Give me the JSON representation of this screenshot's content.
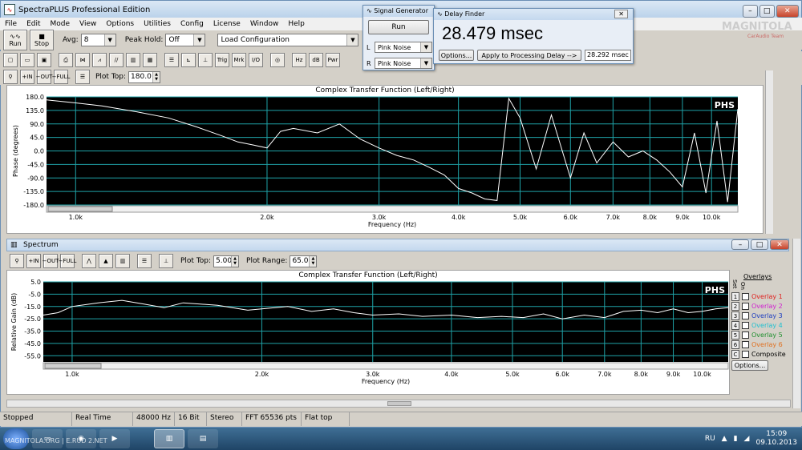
{
  "app": {
    "title": "SpectraPLUS Professional Edition",
    "menu": [
      "File",
      "Edit",
      "Mode",
      "View",
      "Options",
      "Utilities",
      "Config",
      "License",
      "Window",
      "Help"
    ],
    "window_controls": [
      "–",
      "□",
      "✕"
    ]
  },
  "toolbar1": {
    "run_label": "Run",
    "stop_label": "Stop",
    "avg_label": "Avg:",
    "avg_value": "8",
    "peak_hold_label": "Peak Hold:",
    "peak_hold_value": "Off",
    "config_value": "Load Configuration"
  },
  "toolbar2": {
    "buttons": [
      "Trig",
      "Mrk",
      "I/O",
      "Hz",
      "dB",
      "Pwr"
    ]
  },
  "toolbar3": {
    "zoom_labels": [
      "IN",
      "OUT",
      "FULL"
    ],
    "zoom_prefixes": [
      "+",
      "−",
      "−"
    ],
    "plot_top_label": "Plot Top:",
    "plot_top_value": "180.0"
  },
  "phase_chart": {
    "title": "Complex Transfer Function (Left/Right)",
    "ylabel": "Phase (degrees)",
    "xlabel": "Frequency (Hz)",
    "watermark": "PHS"
  },
  "spectrum_window": {
    "title": "Spectrum",
    "plot_top_label": "Plot Top:",
    "plot_top_value": "5.00",
    "plot_range_label": "Plot Range:",
    "plot_range_value": "65.0",
    "chart_title": "Complex Transfer Function (Left/Right)",
    "ylabel": "Relative Gain (dB)",
    "xlabel": "Frequency (Hz)",
    "watermark": "PHS",
    "overlays_title": "Overlays",
    "set_label": "Set",
    "on_label": "On",
    "overlays": [
      {
        "num": "1",
        "name": "Overlay 1",
        "color": "#e0201e"
      },
      {
        "num": "2",
        "name": "Overlay 2",
        "color": "#d020d0"
      },
      {
        "num": "3",
        "name": "Overlay 3",
        "color": "#2040c0"
      },
      {
        "num": "4",
        "name": "Overlay 4",
        "color": "#20c0d0"
      },
      {
        "num": "5",
        "name": "Overlay 5",
        "color": "#209030"
      },
      {
        "num": "6",
        "name": "Overlay 6",
        "color": "#e07020"
      }
    ],
    "composite_num": "C",
    "composite_label": "Composite",
    "options_label": "Options..."
  },
  "signal_generator": {
    "title": "Signal Generator",
    "run_label": "Run",
    "left_label": "L",
    "left_value": "Pink Noise",
    "right_label": "R",
    "right_value": "Pink Noise"
  },
  "delay_finder": {
    "title": "Delay Finder",
    "delay_value": "28.479 msec",
    "options_label": "Options...",
    "apply_label": "Apply to Processing Delay -->",
    "processing_delay": "28.292 msec"
  },
  "statusbar": {
    "items": [
      "Stopped",
      "Real Time",
      "48000 Hz",
      "16 Bit",
      "Stereo",
      "FFT 65536 pts",
      "Flat top"
    ]
  },
  "taskbar": {
    "language": "RU",
    "time": "15:09",
    "date": "09.10.2013",
    "watermark_left": "MAGNITOLA.ORG | E.RUD 2.NET",
    "watermark_right": "MAGNITOLA",
    "watermark_right_sub": "CarAudio Team"
  },
  "chart_data": [
    {
      "type": "line",
      "title": "Complex Transfer Function (Left/Right)",
      "xlabel": "Frequency (Hz)",
      "ylabel": "Phase (degrees)",
      "ylim": [
        -180,
        180
      ],
      "xlim": [
        900,
        11000
      ],
      "x_scale": "log",
      "yticks": [
        "180.0",
        "135.0",
        "90.0",
        "45.0",
        "0.0",
        "-45.0",
        "-90.0",
        "-135.0",
        "-180.0"
      ],
      "ytick_values": [
        180,
        135,
        90,
        45,
        0,
        -45,
        -90,
        -135,
        -180
      ],
      "xticks": [
        "1.0k",
        "2.0k",
        "3.0k",
        "4.0k",
        "5.0k",
        "6.0k",
        "7.0k",
        "8.0k",
        "9.0k",
        "10.0k"
      ],
      "xtick_values": [
        1000,
        2000,
        3000,
        4000,
        5000,
        6000,
        7000,
        8000,
        9000,
        10000
      ],
      "grid": true,
      "series": [
        {
          "x": [
            900,
            1000,
            1100,
            1250,
            1400,
            1550,
            1700,
            1800,
            1900,
            2000,
            2100,
            2200,
            2400,
            2600,
            2800,
            3000,
            3200,
            3400,
            3600,
            3800,
            4000,
            4200,
            4400,
            4600,
            4800,
            5000,
            5300,
            5600,
            6000,
            6300,
            6600,
            7000,
            7400,
            7800,
            8200,
            8600,
            9000,
            9400,
            9800,
            10200,
            10600,
            11000
          ],
          "y": [
            170,
            160,
            150,
            130,
            110,
            80,
            50,
            30,
            20,
            10,
            65,
            75,
            60,
            90,
            40,
            10,
            -15,
            -30,
            -55,
            -80,
            -125,
            -140,
            -160,
            -165,
            175,
            110,
            -60,
            120,
            -90,
            60,
            -40,
            30,
            -20,
            0,
            -30,
            -70,
            -120,
            60,
            -140,
            100,
            -170,
            140
          ]
        }
      ]
    },
    {
      "type": "line",
      "title": "Complex Transfer Function (Left/Right)",
      "xlabel": "Frequency (Hz)",
      "ylabel": "Relative Gain (dB)",
      "ylim": [
        -60,
        5
      ],
      "xlim": [
        900,
        11000
      ],
      "x_scale": "log",
      "yticks": [
        "5.0",
        "-5.0",
        "-15.0",
        "-25.0",
        "-35.0",
        "-45.0",
        "-55.0"
      ],
      "ytick_values": [
        5,
        -5,
        -15,
        -25,
        -35,
        -45,
        -55
      ],
      "xticks": [
        "1.0k",
        "2.0k",
        "3.0k",
        "4.0k",
        "5.0k",
        "6.0k",
        "7.0k",
        "8.0k",
        "9.0k",
        "10.0k"
      ],
      "xtick_values": [
        1000,
        2000,
        3000,
        4000,
        5000,
        6000,
        7000,
        8000,
        9000,
        10000
      ],
      "grid": true,
      "series": [
        {
          "x": [
            900,
            950,
            1000,
            1100,
            1200,
            1300,
            1400,
            1500,
            1700,
            1900,
            2000,
            2200,
            2400,
            2600,
            2800,
            3000,
            3300,
            3600,
            4000,
            4400,
            4800,
            5200,
            5600,
            6000,
            6500,
            7000,
            7500,
            8000,
            8500,
            9000,
            9500,
            10000,
            10500,
            11000
          ],
          "y": [
            -22,
            -20,
            -15,
            -12,
            -10,
            -13,
            -16,
            -12,
            -14,
            -18,
            -17,
            -15,
            -19,
            -17,
            -20,
            -22,
            -21,
            -23,
            -22,
            -24,
            -23,
            -24,
            -21,
            -25,
            -22,
            -24,
            -19,
            -18,
            -20,
            -17,
            -20,
            -19,
            -17,
            -16
          ]
        }
      ]
    }
  ]
}
